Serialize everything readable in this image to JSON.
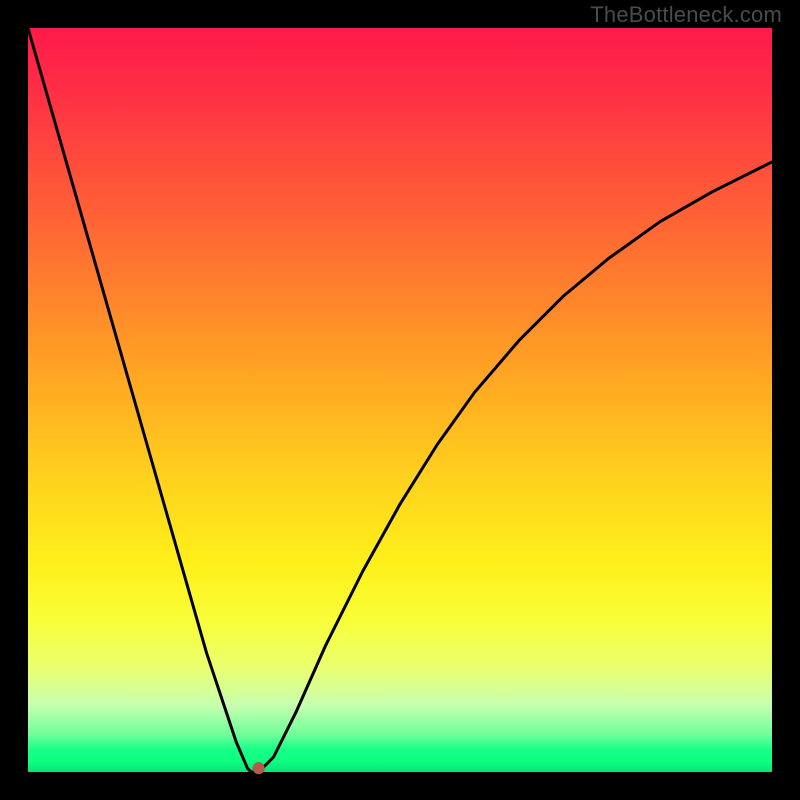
{
  "watermark": "TheBottleneck.com",
  "colors": {
    "background": "#000000",
    "watermark_text": "#4b4b4b",
    "curve_stroke": "#000000",
    "marker_fill": "#b85a4a",
    "gradient_top": "#ff1a4b",
    "gradient_bottom": "#08e37a"
  },
  "chart_data": {
    "type": "line",
    "title": "",
    "xlabel": "",
    "ylabel": "",
    "xlim": [
      0,
      100
    ],
    "ylim": [
      0,
      100
    ],
    "grid": false,
    "legend": false,
    "annotations": [],
    "series": [
      {
        "name": "bottleneck-curve",
        "x": [
          0,
          4,
          8,
          12,
          16,
          20,
          24,
          28,
          29.5,
          30,
          31,
          33,
          36,
          40,
          45,
          50,
          55,
          60,
          66,
          72,
          78,
          85,
          92,
          100
        ],
        "y": [
          100,
          86,
          72,
          58,
          44,
          30,
          16,
          4,
          0.5,
          0,
          0,
          2,
          8,
          17,
          27,
          36,
          44,
          51,
          58,
          64,
          69,
          74,
          78,
          82
        ]
      }
    ],
    "marker": {
      "x": 31,
      "y": 0.5,
      "label": ""
    }
  }
}
